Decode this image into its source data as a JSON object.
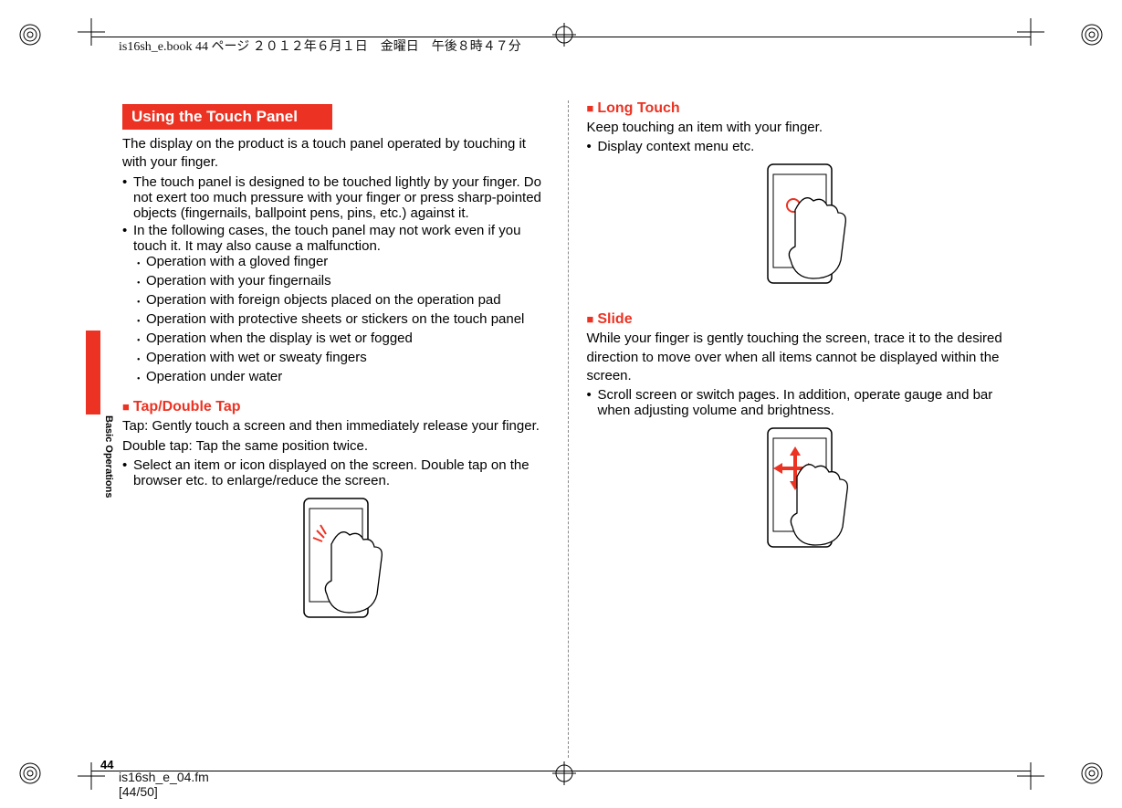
{
  "header": "is16sh_e.book  44 ページ  ２０１２年６月１日　金曜日　午後８時４７分",
  "side_label": "Basic Operations",
  "page_number": "44",
  "footer_line1": "is16sh_e_04.fm",
  "footer_line2": "[44/50]",
  "col1": {
    "section_title": "Using the Touch Panel",
    "intro": "The display on the product is a touch panel operated by touching it with your finger.",
    "b1": "The touch panel is designed to be touched lightly by your finger. Do not exert too much pressure with your finger or press sharp-pointed objects (fingernails, ballpoint pens, pins, etc.) against it.",
    "b2": "In the following cases, the touch panel may not work even if you touch it. It may also cause a malfunction.",
    "sb1": "Operation with a gloved finger",
    "sb2": "Operation with your fingernails",
    "sb3": "Operation with foreign objects placed on the operation pad",
    "sb4": "Operation with protective sheets or stickers on the touch panel",
    "sb5": "Operation when the display is wet or fogged",
    "sb6": "Operation with wet or sweaty fingers",
    "sb7": "Operation under water",
    "sub1_title": "Tap/Double Tap",
    "sub1_l1": "Tap: Gently touch a screen and then immediately release your finger.",
    "sub1_l2": "Double tap: Tap the same position twice.",
    "sub1_b1": "Select an item or icon displayed on the screen. Double tap on the browser etc. to enlarge/reduce the screen."
  },
  "col2": {
    "sub2_title": "Long Touch",
    "sub2_l1": "Keep touching an item with your finger.",
    "sub2_b1": "Display context menu etc.",
    "sub3_title": "Slide",
    "sub3_l1": "While your finger is gently touching the screen, trace it to the desired direction to move over when all items cannot be displayed within the screen.",
    "sub3_b1": "Scroll screen or switch pages. In addition, operate gauge and bar when adjusting volume and brightness."
  }
}
